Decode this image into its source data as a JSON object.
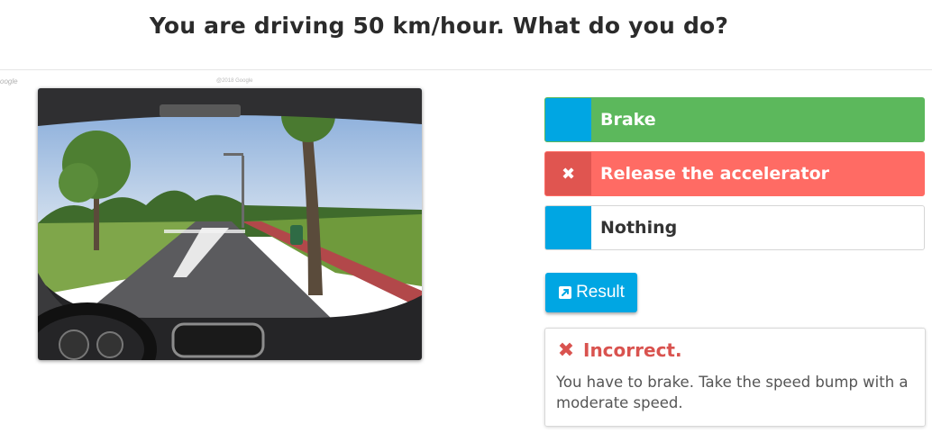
{
  "question": {
    "title": "You are driving 50 km/hour. What do you do?"
  },
  "image": {
    "watermark": "oogle",
    "capture_text": "@2018 Google"
  },
  "answers": [
    {
      "label": "Brake",
      "marker_symbol": "",
      "state": "correct"
    },
    {
      "label": "Release the accelerator",
      "marker_symbol": "✖",
      "state": "selected-wrong"
    },
    {
      "label": "Nothing",
      "marker_symbol": "",
      "state": "neutral"
    }
  ],
  "result_button": {
    "label": "Result",
    "icon": "external-link-icon"
  },
  "feedback": {
    "icon": "x-icon",
    "title": "Incorrect.",
    "text": "You have to brake. Take the speed bump with a moderate speed."
  },
  "colors": {
    "accent": "#00a6e3",
    "correct": "#5cb85c",
    "wrong": "#ff6b64",
    "error_text": "#d9534f"
  }
}
